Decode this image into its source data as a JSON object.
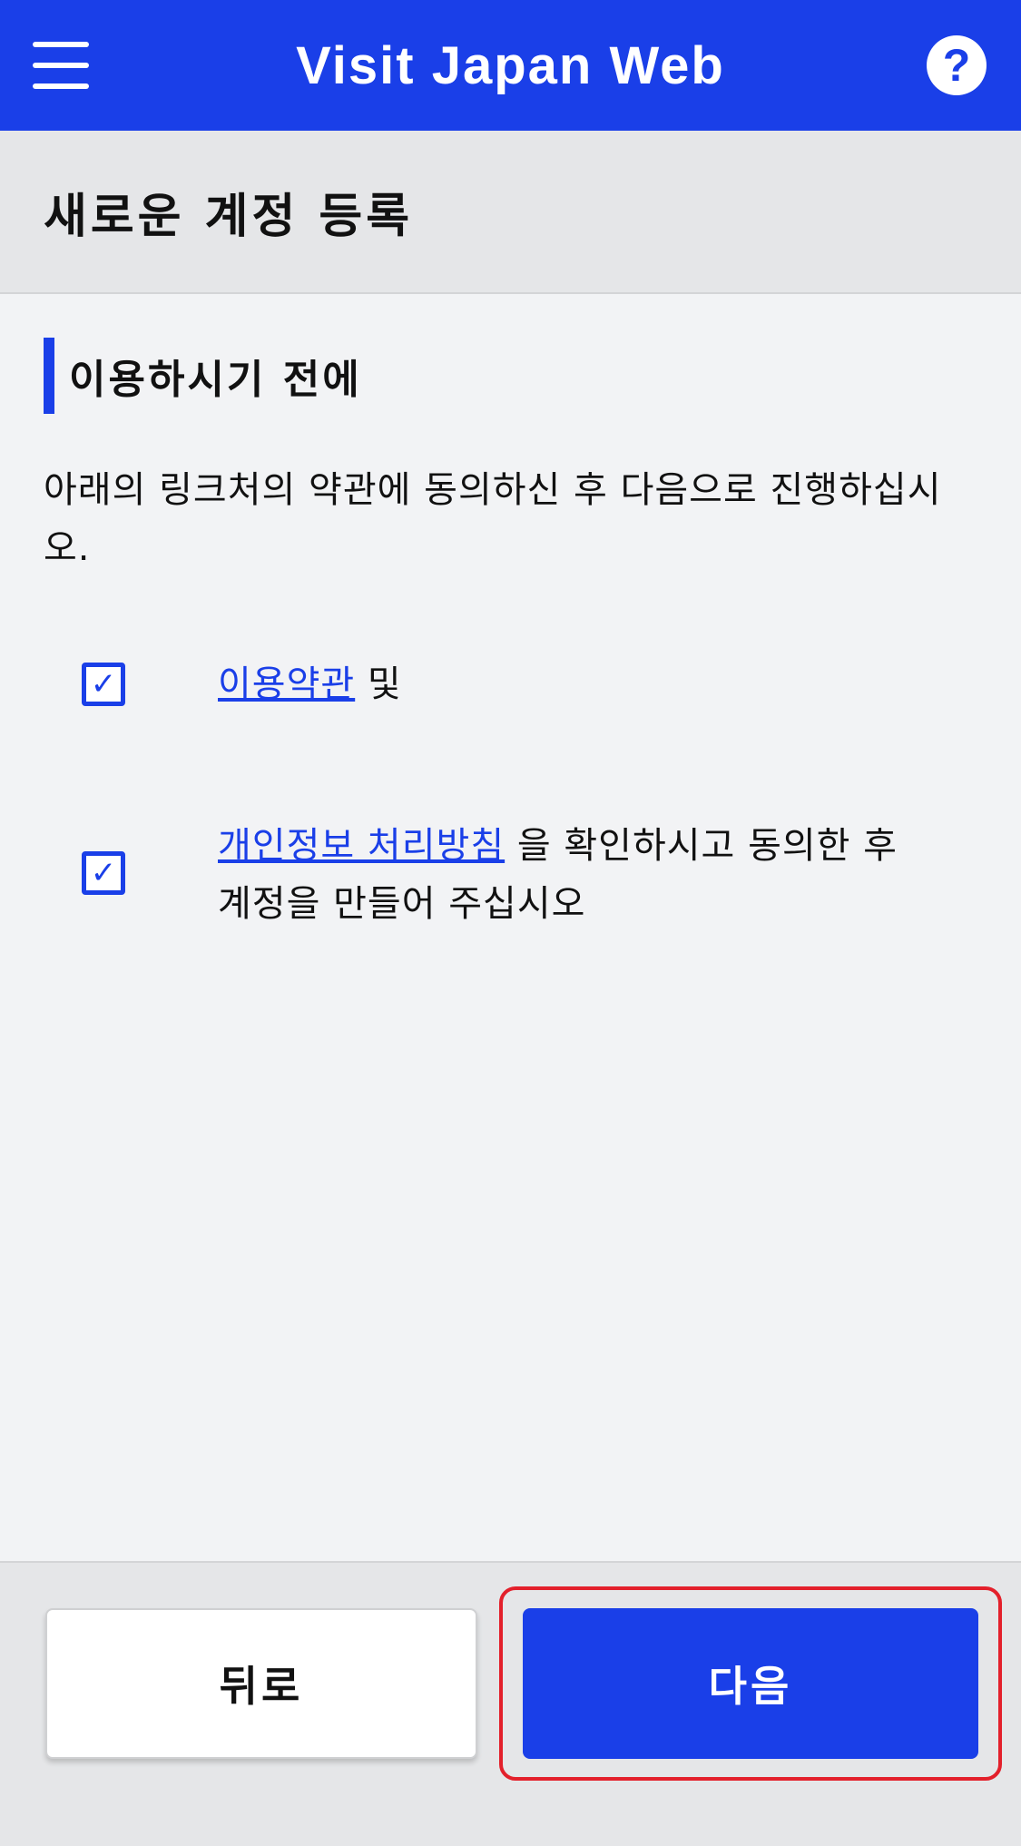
{
  "header": {
    "title": "Visit Japan Web",
    "menu_icon": "hamburger-menu-icon",
    "help_icon": "help-circle-icon",
    "help_glyph": "?"
  },
  "page": {
    "title": "새로운 계정 등록"
  },
  "section": {
    "heading": "이용하시기 전에",
    "intro": "아래의 링크처의 약관에 동의하신 후 다음으로 진행하십시오."
  },
  "agreements": [
    {
      "checked": true,
      "link_text": "이용약관",
      "suffix": "및"
    },
    {
      "checked": true,
      "link_text": "개인정보 처리방침",
      "suffix": " 을 확인하시고 동의한 후 계정을 만들어 주십시오"
    }
  ],
  "footer": {
    "back_label": "뒤로",
    "next_label": "다음"
  },
  "colors": {
    "brand": "#1a3fe8",
    "highlight": "#e3202b"
  }
}
